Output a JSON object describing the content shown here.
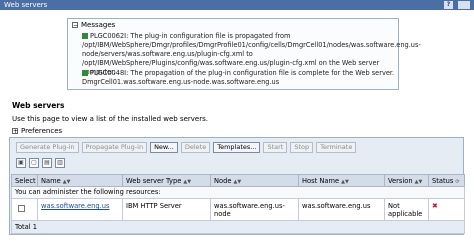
{
  "window": {
    "title": "Web servers",
    "help_icon": "?"
  },
  "messages": {
    "heading": "Messages",
    "items": [
      "PLGC0062I: The plug-in configuration file is propagated from /opt/IBM/WebSphere/Dmgr/profiles/DmgrProfile01/config/cells/DmgrCell01/nodes/was.software.eng.us-node/servers/was.software.eng.us/plugin-cfg.xml to /opt/IBM/WebSphere/Plugins/config/was.software.eng.us/plugin-cfg.xml on the Web server computer.",
      "PLGC0048I: The propagation of the plug-in configuration file is complete for the Web server. DmgrCell01.was.software.eng.us-node.was.software.eng.us"
    ]
  },
  "section": {
    "title": "Web servers",
    "description": "Use this page to view a list of the installed web servers.",
    "preferences": "Preferences"
  },
  "toolbar": {
    "generate": "Generate Plug-in",
    "propagate": "Propagate Plug-in",
    "new": "New...",
    "delete": "Delete",
    "templates": "Templates...",
    "start": "Start",
    "stop": "Stop",
    "terminate": "Terminate"
  },
  "table": {
    "headers": {
      "select": "Select",
      "name": "Name",
      "type": "Web server Type",
      "node": "Node",
      "host": "Host Name",
      "version": "Version",
      "status": "Status"
    },
    "info_row": "You can administer the following resources:",
    "rows": [
      {
        "name": "was.software.eng.us",
        "type": "IBM HTTP Server",
        "node": "was.software.eng.us-node",
        "host": "was.software.eng.us",
        "version": "Not applicable",
        "status_icon": "stopped-x-icon"
      }
    ],
    "total": "Total 1"
  },
  "colors": {
    "title_bar": "#4a6fa5",
    "panel_bg": "#e5ecf4",
    "link": "#1a4da2",
    "status_stopped": "#c8102e",
    "success_icon": "#2e8b3a"
  }
}
